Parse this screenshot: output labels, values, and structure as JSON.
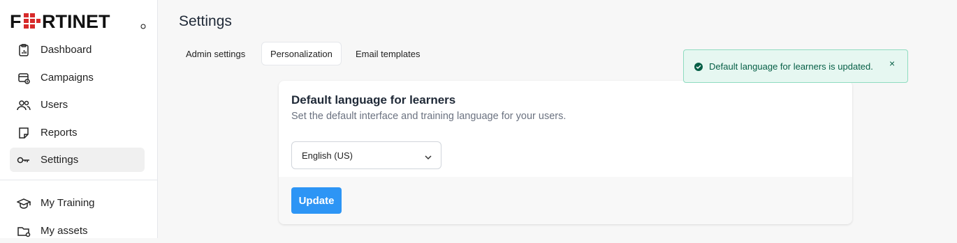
{
  "brand": {
    "name": "FORTINET",
    "accent": "#d72a2a"
  },
  "sidebar": {
    "items": [
      {
        "label": "Dashboard",
        "icon": "dashboard-icon"
      },
      {
        "label": "Campaigns",
        "icon": "campaigns-icon"
      },
      {
        "label": "Users",
        "icon": "users-icon"
      },
      {
        "label": "Reports",
        "icon": "reports-icon"
      },
      {
        "label": "Settings",
        "icon": "key-icon",
        "active": true
      },
      {
        "label": "My Training",
        "icon": "graduation-cap-icon"
      },
      {
        "label": "My assets",
        "icon": "folder-icon"
      }
    ]
  },
  "page": {
    "title": "Settings"
  },
  "tabs": [
    {
      "label": "Admin settings"
    },
    {
      "label": "Personalization",
      "active": true
    },
    {
      "label": "Email templates"
    }
  ],
  "card": {
    "title": "Default language for learners",
    "description": "Set the default interface and training language for your users.",
    "select_value": "English (US)",
    "button_label": "Update"
  },
  "toast": {
    "message": "Default language for learners is updated.",
    "close_glyph": "×",
    "color": "#065f46"
  },
  "colors": {
    "primary": "#2d95f5",
    "success_bg": "#e6f7f1"
  }
}
